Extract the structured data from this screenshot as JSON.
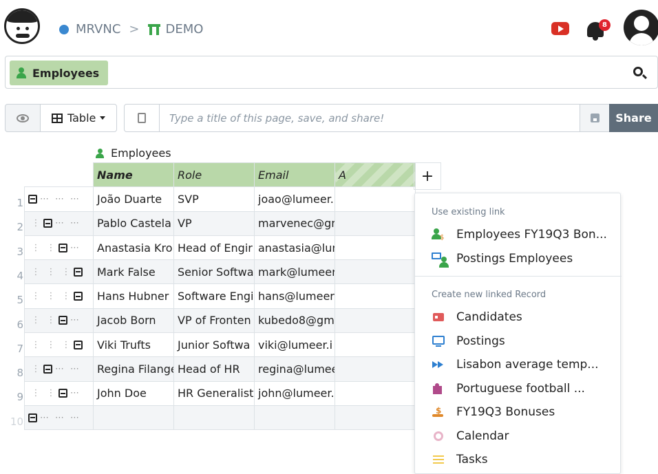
{
  "breadcrumb": {
    "org": "MRVNC",
    "project": "DEMO"
  },
  "notifications": {
    "count": "8"
  },
  "search": {
    "chip_label": "Employees"
  },
  "toolbar": {
    "view_label": "Table",
    "title_placeholder": "Type a title of this page, save, and share!",
    "share_label": "Share"
  },
  "table": {
    "title": "Employees",
    "headers": [
      "Name",
      "Role",
      "Email",
      "A"
    ],
    "rows": [
      {
        "num": "1",
        "name": "João Duarte",
        "role": "SVP",
        "email": "joao@lumeer.i"
      },
      {
        "num": "2",
        "name": "Pablo Castela",
        "role": "VP",
        "email": "marvenec@gn"
      },
      {
        "num": "3",
        "name": "Anastasia Kro",
        "role": "Head of Engir",
        "email": "anastasia@lun"
      },
      {
        "num": "4",
        "name": "Mark False",
        "role": "Senior Softwa",
        "email": "mark@lumeer"
      },
      {
        "num": "5",
        "name": "Hans Hubner",
        "role": "Software Engi",
        "email": "hans@lumeer."
      },
      {
        "num": "6",
        "name": "Jacob Born",
        "role": "VP of Fronten",
        "email": "kubedo8@gm"
      },
      {
        "num": "7",
        "name": "Viki Trufts",
        "role": "Junior Softwa",
        "email": "viki@lumeer.i"
      },
      {
        "num": "8",
        "name": "Regina Filange",
        "role": "Head of HR",
        "email": "regina@lumee"
      },
      {
        "num": "9",
        "name": "John Doe",
        "role": "HR Generalist",
        "email": "john@lumeer."
      },
      {
        "num": "10",
        "name": "",
        "role": "",
        "email": ""
      }
    ],
    "add_column_label": "+"
  },
  "menu": {
    "existing_heading": "Use existing link",
    "existing": [
      "Employees FY19Q3 Bon...",
      "Postings Employees"
    ],
    "create_heading": "Create new linked Record",
    "create": [
      "Candidates",
      "Postings",
      "Lisabon average temp...",
      "Portuguese football ...",
      "FY19Q3 Bonuses",
      "Calendar",
      "Tasks"
    ]
  },
  "colors": {
    "accent_green": "#3aa54a",
    "header_green": "#b9d8a9",
    "share_bg": "#5f6d7a",
    "badge_red": "#e0242e"
  }
}
